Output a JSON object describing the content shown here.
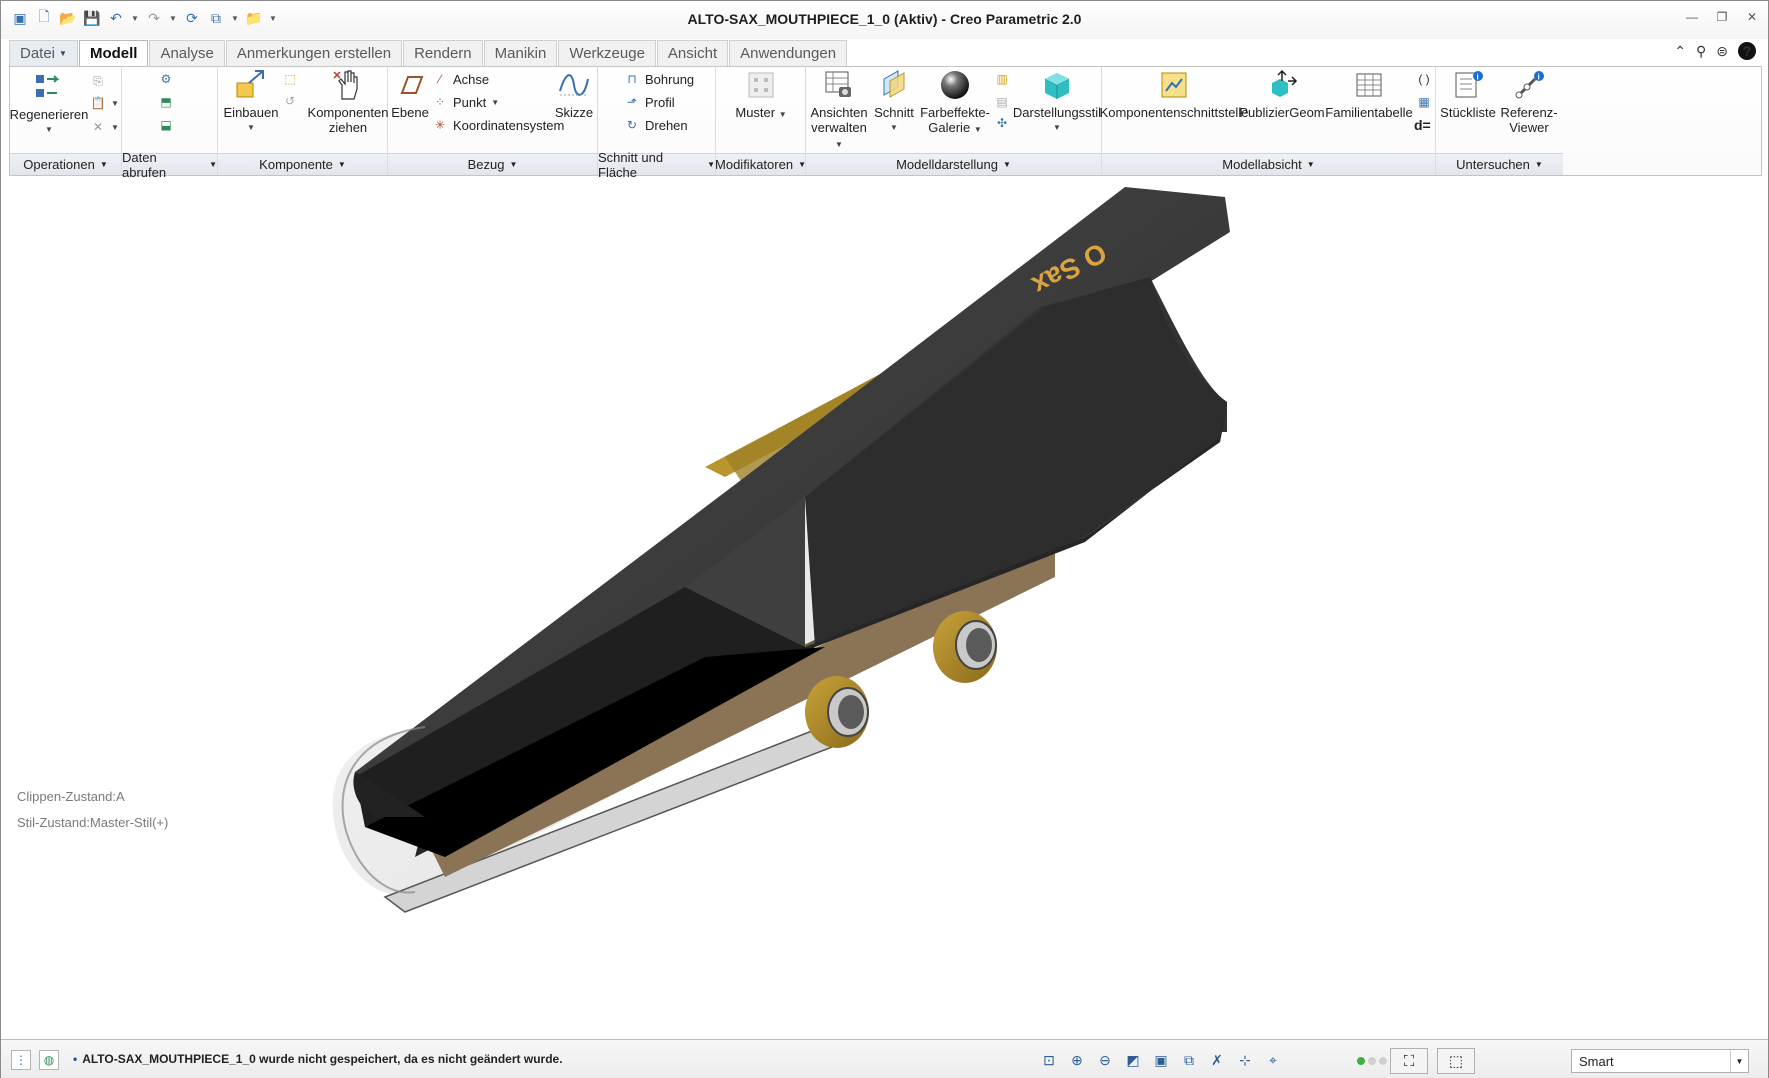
{
  "window": {
    "title": "ALTO-SAX_MOUTHPIECE_1_0 (Aktiv) - Creo Parametric 2.0"
  },
  "tabs": [
    {
      "label": "Datei"
    },
    {
      "label": "Modell"
    },
    {
      "label": "Analyse"
    },
    {
      "label": "Anmerkungen erstellen"
    },
    {
      "label": "Rendern"
    },
    {
      "label": "Manikin"
    },
    {
      "label": "Werkzeuge"
    },
    {
      "label": "Ansicht"
    },
    {
      "label": "Anwendungen"
    }
  ],
  "ribbon": {
    "groups": [
      {
        "label": "Operationen"
      },
      {
        "label": "Daten abrufen"
      },
      {
        "label": "Komponente"
      },
      {
        "label": "Bezug"
      },
      {
        "label": "Schnitt und Fläche"
      },
      {
        "label": "Modifikatoren"
      },
      {
        "label": "Modelldarstellung"
      },
      {
        "label": "Modellabsicht"
      },
      {
        "label": "Untersuchen"
      }
    ],
    "buttons": {
      "regenerieren": "Regenerieren",
      "einbauen": "Einbauen",
      "komponenten_ziehen_1": "Komponenten",
      "komponenten_ziehen_2": "ziehen",
      "ebene": "Ebene",
      "achse": "Achse",
      "punkt": "Punkt",
      "koordinatensystem": "Koordinatensystem",
      "skizze": "Skizze",
      "bohrung": "Bohrung",
      "profil": "Profil",
      "drehen": "Drehen",
      "muster": "Muster",
      "ansichten_1": "Ansichten",
      "ansichten_2": "verwalten",
      "schnitt": "Schnitt",
      "farbeffekte_1": "Farbeffekte-",
      "farbeffekte_2": "Galerie",
      "darstellungsstil": "Darstellungsstil",
      "komponentenschnittstelle": "Komponentenschnittstelle",
      "publiziergeom": "PublizierGeom",
      "familientabelle": "Familientabelle",
      "stueckliste": "Stückliste",
      "referenz_1": "Referenz-",
      "referenz_2": "Viewer",
      "d_eq": "d="
    }
  },
  "viewport": {
    "clip_state": "Clippen-Zustand:A",
    "style_state": "Stil-Zustand:Master-Stil(+)",
    "engraving": "O Sax"
  },
  "status": {
    "message": "ALTO-SAX_MOUTHPIECE_1_0 wurde nicht gespeichert, da es nicht geändert wurde.",
    "filter": "Smart"
  },
  "icons": {
    "accent": "#3a6fb0",
    "status_green": "#3cb043"
  }
}
